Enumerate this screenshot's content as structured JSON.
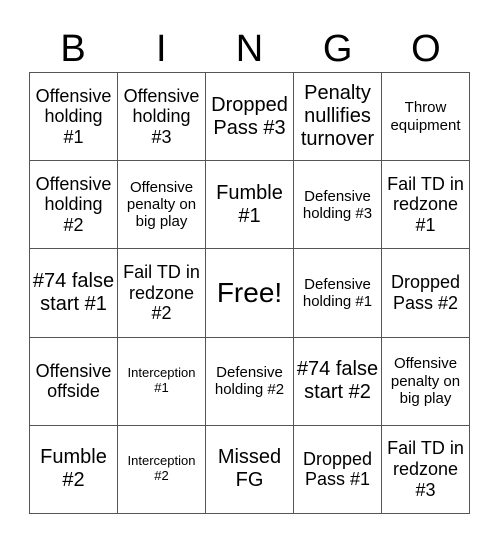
{
  "header": {
    "letters": [
      "B",
      "I",
      "N",
      "G",
      "O"
    ]
  },
  "cells": [
    {
      "text": "Offensive holding #1",
      "size": "md"
    },
    {
      "text": "Offensive holding #3",
      "size": "md"
    },
    {
      "text": "Dropped Pass #3",
      "size": "lg"
    },
    {
      "text": "Penalty nullifies turnover",
      "size": "lg"
    },
    {
      "text": "Throw equipment",
      "size": "sm"
    },
    {
      "text": "Offensive holding #2",
      "size": "md"
    },
    {
      "text": "Offensive penalty on big play",
      "size": "sm"
    },
    {
      "text": "Fumble #1",
      "size": "lg"
    },
    {
      "text": "Defensive holding #3",
      "size": "sm"
    },
    {
      "text": "Fail TD in redzone #1",
      "size": "md"
    },
    {
      "text": "#74 false start #1",
      "size": "lg"
    },
    {
      "text": "Fail TD in redzone #2",
      "size": "md"
    },
    {
      "text": "Free!",
      "size": "xl"
    },
    {
      "text": "Defensive holding #1",
      "size": "sm"
    },
    {
      "text": "Dropped Pass #2",
      "size": "md"
    },
    {
      "text": "Offensive offside",
      "size": "md"
    },
    {
      "text": "Interception #1",
      "size": "xs"
    },
    {
      "text": "Defensive holding #2",
      "size": "sm"
    },
    {
      "text": "#74 false start #2",
      "size": "lg"
    },
    {
      "text": "Offensive penalty on big play",
      "size": "sm"
    },
    {
      "text": "Fumble #2",
      "size": "lg"
    },
    {
      "text": "Interception #2",
      "size": "xs"
    },
    {
      "text": "Missed FG",
      "size": "lg"
    },
    {
      "text": "Dropped Pass #1",
      "size": "md"
    },
    {
      "text": "Fail TD in redzone #3",
      "size": "md"
    }
  ]
}
